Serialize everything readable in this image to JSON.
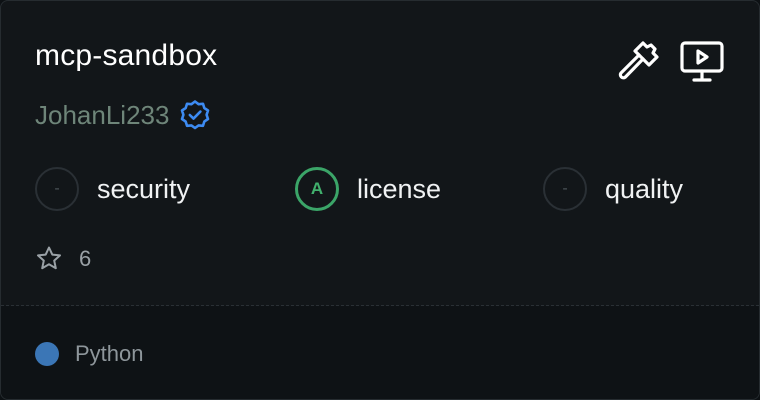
{
  "repo": {
    "name": "mcp-sandbox",
    "author": "JohanLi233",
    "stars": "6"
  },
  "icons": {
    "verified": "verified-badge-icon",
    "hammer": "hammer-icon",
    "monitor_play": "monitor-play-icon",
    "star": "star-icon"
  },
  "metrics": [
    {
      "grade": "-",
      "label": "security"
    },
    {
      "grade": "A",
      "label": "license"
    },
    {
      "grade": "-",
      "label": "quality"
    }
  ],
  "language": {
    "name": "Python",
    "color": "#3b76b6"
  },
  "colors": {
    "verified": "#3d8bf2",
    "grade_a": "#3ba568",
    "author": "#6e8579"
  }
}
